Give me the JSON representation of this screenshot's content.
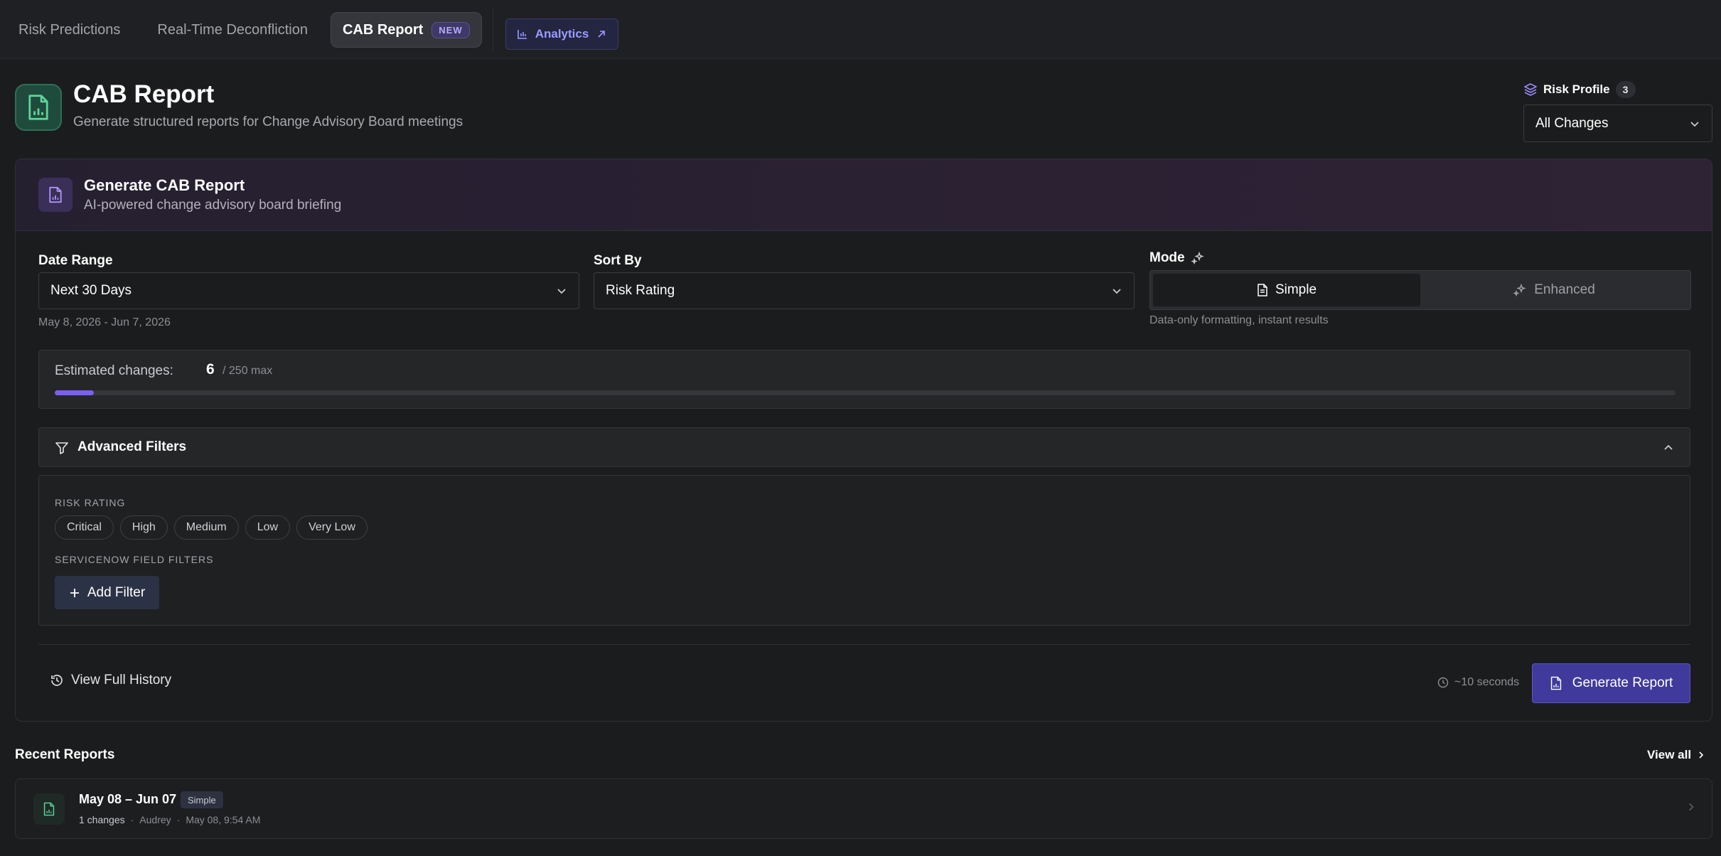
{
  "tabs": [
    {
      "label": "Risk Predictions"
    },
    {
      "label": "Real-Time Deconfliction"
    },
    {
      "label": "CAB Report",
      "badge": "NEW"
    }
  ],
  "analytics_label": "Analytics",
  "header": {
    "title": "CAB Report",
    "subtitle": "Generate structured reports for Change Advisory Board meetings",
    "risk_profile_label": "Risk Profile",
    "risk_profile_count": "3",
    "risk_profile_value": "All Changes"
  },
  "card": {
    "title": "Generate CAB Report",
    "subtitle": "AI-powered change advisory board briefing",
    "date_range": {
      "label": "Date Range",
      "value": "Next 30 Days",
      "helper": "May 8, 2026 - Jun 7, 2026"
    },
    "sort_by": {
      "label": "Sort By",
      "value": "Risk Rating"
    },
    "mode": {
      "label": "Mode",
      "options": [
        "Simple",
        "Enhanced"
      ],
      "selected": "Simple",
      "helper": "Data-only formatting, instant results"
    },
    "estimate": {
      "label": "Estimated changes:",
      "value": "6",
      "max": "/ 250 max",
      "fraction": 0.024
    },
    "advanced": {
      "title": "Advanced Filters",
      "risk_caption": "RISK RATING",
      "risk_options": [
        "Critical",
        "High",
        "Medium",
        "Low",
        "Very Low"
      ],
      "servicenow_caption": "SERVICENOW FIELD FILTERS",
      "add_filter_label": "Add Filter"
    },
    "history_label": "View Full History",
    "eta": "~10 seconds",
    "generate_label": "Generate Report"
  },
  "recent": {
    "title": "Recent Reports",
    "view_all": "View all",
    "items": [
      {
        "title": "May 08 – Jun 07",
        "tag": "Simple",
        "changes": "1 changes",
        "author": "Audrey",
        "time": "May 08, 9:54 AM"
      }
    ]
  },
  "colors": {
    "accent": "#7b5ff0",
    "primary_button": "#3f3a9b",
    "success_icon": "#5fd69c"
  }
}
